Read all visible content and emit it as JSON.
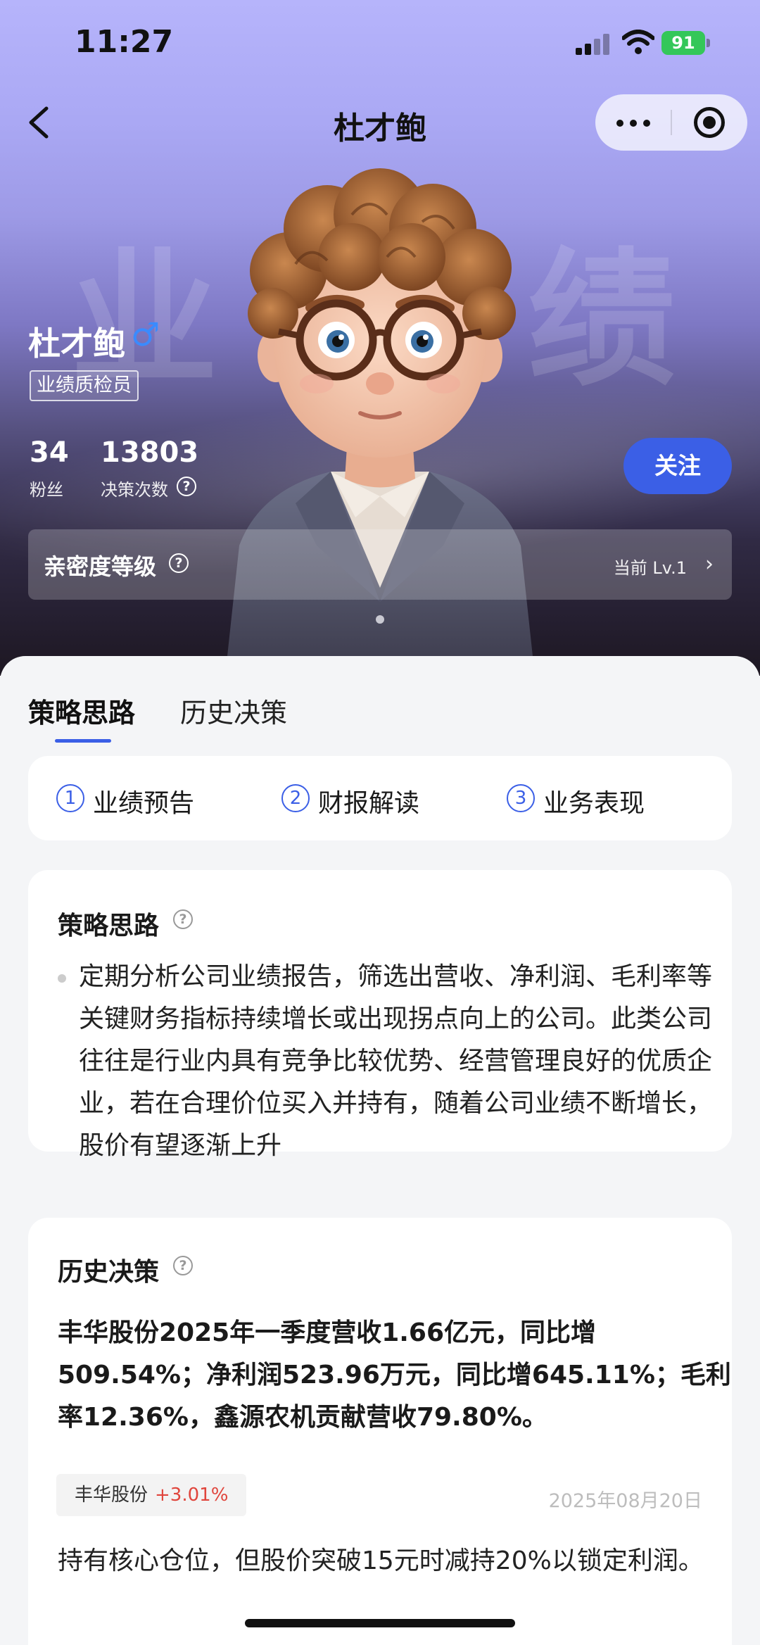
{
  "status_bar": {
    "time": "11:27",
    "battery": "91"
  },
  "nav": {
    "title": "杜才鲍"
  },
  "hero": {
    "watermark_left": "业",
    "watermark_right": "绩"
  },
  "profile": {
    "name": "杜才鲍",
    "gender_symbol": "♂",
    "role": "业绩质检员",
    "fans_count": "34",
    "fans_label": "粉丝",
    "decisions_count": "13803",
    "decisions_label": "决策次数",
    "follow_label": "关注"
  },
  "intimacy": {
    "title": "亲密度等级",
    "value": "当前 Lv.1"
  },
  "tabs": [
    {
      "label": "策略思路",
      "active": true
    },
    {
      "label": "历史决策",
      "active": false
    }
  ],
  "steps": [
    {
      "num": "1",
      "label": "业绩预告"
    },
    {
      "num": "2",
      "label": "财报解读"
    },
    {
      "num": "3",
      "label": "业务表现"
    }
  ],
  "strategy": {
    "title": "策略思路",
    "text": "定期分析公司业绩报告，筛选出营收、净利润、毛利率等关键财务指标持续增长或出现拐点向上的公司。此类公司往往是行业内具有竞争比较优势、经营管理良好的优质企业，若在合理价位买入并持有，随着公司业绩不断增长，股价有望逐渐上升"
  },
  "history": {
    "title": "历史决策",
    "items": [
      {
        "text": "丰华股份2025年一季度营收1.66亿元，同比增509.54%；净利润523.96万元，同比增645.11%；毛利率12.36%，鑫源农机贡献营收79.80%。",
        "stock": "丰华股份",
        "change": "+3.01%",
        "date": "2025年08月20日",
        "action": "持有核心仓位，但股价突破15元时减持20%以锁定利润。"
      }
    ]
  },
  "colors": {
    "accent": "#3b5fe6",
    "up": "#e0453c",
    "battery": "#34c759",
    "gender": "#3a8bff"
  },
  "icons": [
    "back-icon",
    "more-icon",
    "close-miniprogram-icon",
    "help-icon",
    "chevron-right-icon",
    "signal-icon",
    "wifi-icon",
    "battery-icon"
  ]
}
